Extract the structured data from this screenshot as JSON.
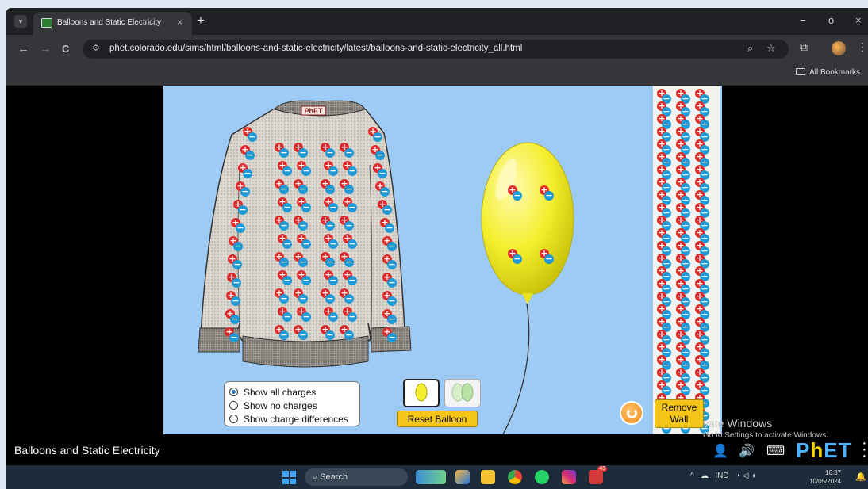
{
  "browser": {
    "tab_title": "Balloons and Static Electricity",
    "close_glyph": "×",
    "new_tab_glyph": "+",
    "url": "phet.colorado.edu/sims/html/balloons-and-static-electricity/latest/balloons-and-static-electricity_all.html",
    "bookmarks_label": "All Bookmarks",
    "nav": {
      "back": "←",
      "forward": "→",
      "reload": "C"
    },
    "window": {
      "minimize": "−",
      "maximize": "o",
      "close": "×"
    }
  },
  "sim": {
    "sweater_label": "PhET",
    "charge_options": [
      {
        "label": "Show all charges",
        "selected": true
      },
      {
        "label": "Show no charges",
        "selected": false
      },
      {
        "label": "Show charge differences",
        "selected": false
      }
    ],
    "reset_balloon_label": "Reset Balloon",
    "remove_wall_label": "Remove Wall",
    "balloon_color": "#f4ee2c",
    "background_color": "#9dcbf5"
  },
  "navbar": {
    "sim_title": "Balloons and Static Electricity",
    "logo": {
      "p": "P",
      "h": "h",
      "et": "ET"
    }
  },
  "watermark": {
    "line1": "vate Windows",
    "line2": "Go to Settings to activate Windows."
  },
  "taskbar": {
    "search_placeholder": "Search",
    "language": "IND",
    "time": "16:37",
    "date": "10/05/2024",
    "badge_count": "43"
  },
  "icons": [
    "menu-icon",
    "tab-favicon-icon",
    "close-icon",
    "back-icon",
    "forward-icon",
    "reload-icon",
    "site-settings-icon",
    "zoom-icon",
    "star-icon",
    "extensions-icon",
    "profile-icon",
    "more-icon",
    "folder-icon",
    "reset-all-icon",
    "people-icon",
    "sound-icon",
    "keyboard-icon",
    "windows-start-icon",
    "search-icon",
    "notification-icon"
  ]
}
